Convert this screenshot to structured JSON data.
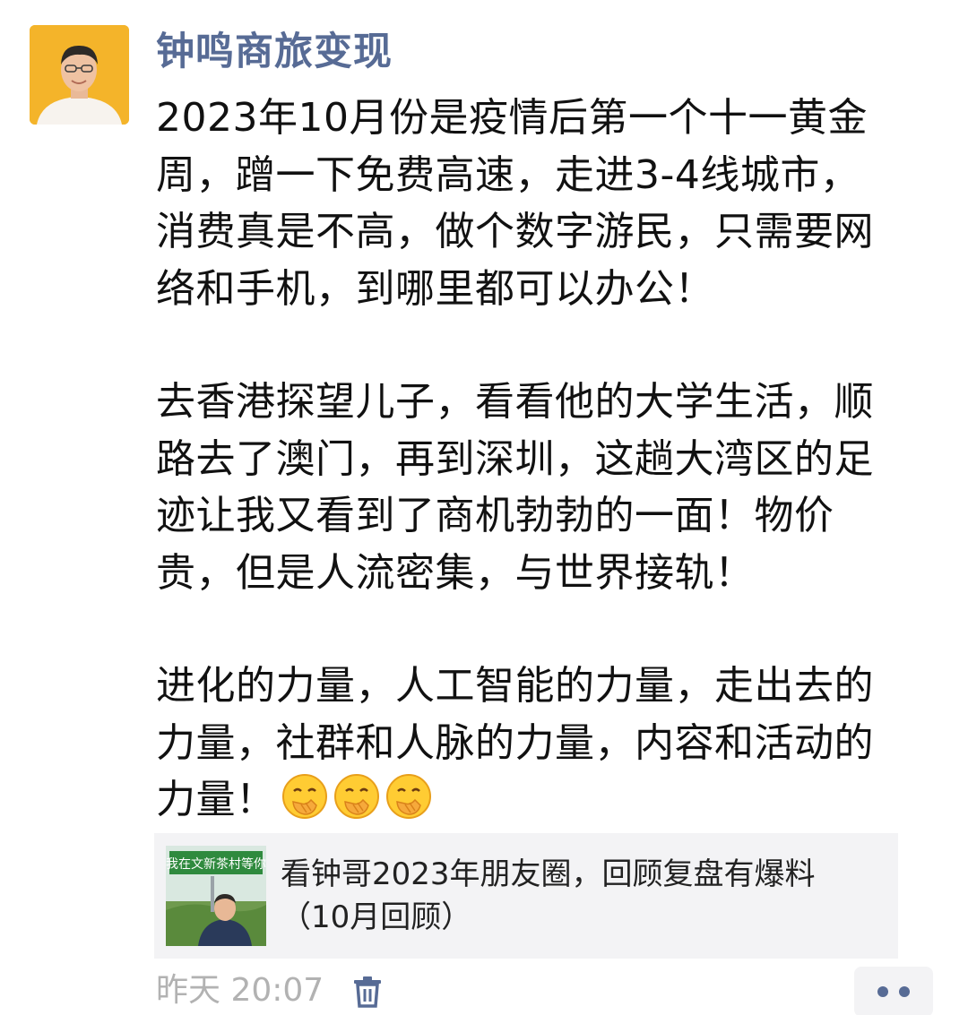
{
  "author": {
    "name": "钟鸣商旅变现",
    "avatar_icon": "person-portrait-icon"
  },
  "post": {
    "paragraphs": [
      "2023年10月份是疫情后第一个十一黄金\n周，蹭一下免费高速，走进3-4线城市，\n消费真是不高，做个数字游民，只需要网\n络和手机，到哪里都可以办公！",
      "去香港探望儿子，看看他的大学生活，顺\n路去了澳门，再到深圳，这趟大湾区的足\n迹让我又看到了商机勃勃的一面！物价\n贵，但是人流密集，与世界接轨！",
      "进化的力量，人工智能的力量，走出去的\n力量，社群和人脉的力量，内容和活动的\n力量！"
    ],
    "emoji_icon": "face-with-hand-over-mouth-icon",
    "emoji_count": 3
  },
  "link_card": {
    "title": "看钟哥2023年朋友圈，回顾复盘有爆料（10月回顾）",
    "thumb_sign_text": "我在文新茶村等你"
  },
  "footer": {
    "timestamp": "昨天 20:07",
    "delete_icon": "trash-icon",
    "more_icon": "more-dots-icon"
  },
  "colors": {
    "name_link": "#576b95",
    "body_text": "#111111",
    "meta_text": "#b2b2b2",
    "card_bg": "#f3f3f5",
    "avatar_bg": "#f4b42a"
  }
}
